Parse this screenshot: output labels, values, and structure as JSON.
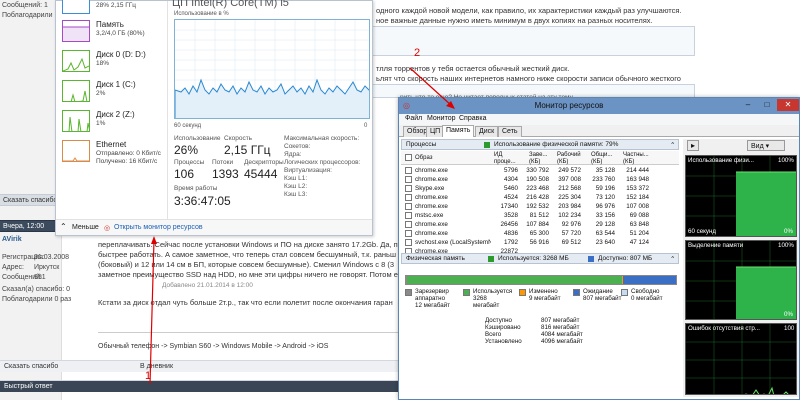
{
  "forum": {
    "left": {
      "top_line1": "Сообщений: 1",
      "top_line2": "Поблагодарили 1 раз",
      "bar1": "Сказать спасибо",
      "bar2": "Вчера, 12:00",
      "user": "AVirik",
      "reg_label": "Регистрация:",
      "reg_value": "31.03.2008",
      "addr_label": "Адрес:",
      "addr_value": "Иркутск",
      "msgs_label": "Сообщений:",
      "msgs_value": "951",
      "thanked_label": "Сказал(а) спасибо: 0",
      "thanked2_label": "Поблагодарили 0 раз"
    },
    "top_right": {
      "line1": "одного каждой новой модели, как правило, их характеристики каждый раз улучшаются.",
      "line2": "ное важные данные нужно иметь минимум в двух копиях на разных носителях.",
      "line3": "тлля торрентов у тебя остается обычный жесткий диск.",
      "line4": "ьлят что скорость наших интернетов намного ниже скорости записи обычного жесткого",
      "line5": "рить что-то еще? Не читает поводных статей на эту тему"
    },
    "post": {
      "l1": "переплачивать. Сейчас после установки Windows и ПО на диске занято 17.2Gb. Да, п",
      "l2": "быстрее работать. А самое заметное, что теперь стал совсем бесшумный, т.к. раньш",
      "l3": "(боковый) и 12 или 14 см в БП, которые совсем бесшумные). Сменил Windows с 8 (3",
      "l4": "заметное преимущество SSD над HDD, но мне эти цифры ничего не говорят. Потом ещ",
      "added": "Добавлено 21.01.2014 в 12:00",
      "l5": "Кстати за диск отдал чуть больше 2т.р., так что если полетит после окончания гаран",
      "signature": "Обычный телефон -> Symbian S60 -> Windows Mobile -> Android -> iOS"
    },
    "bottom": {
      "bar1_left": "Сказать спасибо",
      "bar1_right": "В дневник",
      "bar2": "Быстрый ответ"
    }
  },
  "taskmgr": {
    "side": [
      {
        "name": "",
        "sub": "28% 2,15 ГГц",
        "sub2": ""
      },
      {
        "name": "Память",
        "sub": "3,2/4,0 ГБ (80%)",
        "sub2": ""
      },
      {
        "name": "Диск 0 (D: D:)",
        "sub": "18%",
        "sub2": ""
      },
      {
        "name": "Диск 1 (C:)",
        "sub": "2%",
        "sub2": ""
      },
      {
        "name": "Диск 2 (Z:)",
        "sub": "1%",
        "sub2": ""
      },
      {
        "name": "Ethernet",
        "sub": "Отправлено: 0 Кбит/с",
        "sub2": "Получено: 16 Кбит/с"
      }
    ],
    "title": "ЦП     Intel(R) Core(TM) i5",
    "util_label": "Использование в %",
    "sixty": "60 секунд",
    "zero": "0",
    "usage_label": "Использование",
    "usage_value": "26%",
    "speed_label": "Скорость",
    "speed_value": "2,15 ГГц",
    "proc_label": "Процессы",
    "proc_value": "106",
    "threads_label": "Потоки",
    "threads_value": "1393",
    "handles_label": "Дескрипторы",
    "handles_value": "45444",
    "uptime_label": "Время работы",
    "uptime_value": "3:36:47:05",
    "right_labels": [
      "Максимальная скорость:",
      "Сокетов:",
      "Ядра:",
      "Логических процессоров:",
      "Виртуализация:",
      "Кэш L1:",
      "Кэш L2:",
      "Кэш L3:"
    ],
    "less": "Меньше",
    "open_resmon": "Открыть монитор ресурсов"
  },
  "resmon": {
    "title": "Монитор ресурсов",
    "menu": [
      "Файл",
      "Монитор",
      "Справка"
    ],
    "tabs": [
      "Обзор",
      "ЦП",
      "Память",
      "Диск",
      "Сеть"
    ],
    "active_tab": "Память",
    "proc_section": "Процессы",
    "proc_usage": "Использование физической памяти: 79%",
    "columns": [
      "Образ",
      "ИД\nпроце...",
      "Заве...\n(КБ)",
      "Рабочий\n(КБ)",
      "Общи...\n(КБ)",
      "Частны...\n(КБ)"
    ],
    "rows": [
      [
        "chrome.exe",
        "5796",
        "330 792",
        "249 572",
        "35 128",
        "214 444"
      ],
      [
        "chrome.exe",
        "4304",
        "190 508",
        "397 008",
        "233 760",
        "163 948"
      ],
      [
        "Skype.exe",
        "5460",
        "223 468",
        "212 568",
        "59 196",
        "153 372"
      ],
      [
        "chrome.exe",
        "4524",
        "216 428",
        "225 304",
        "73 120",
        "152 184"
      ],
      [
        "chrome.exe",
        "17340",
        "192 532",
        "203 984",
        "96 976",
        "107 008"
      ],
      [
        "mstsc.exe",
        "3528",
        "81 512",
        "102 234",
        "33 156",
        "69 088"
      ],
      [
        "chrome.exe",
        "26456",
        "107 884",
        "92 976",
        "29 128",
        "63 848"
      ],
      [
        "chrome.exe",
        "4836",
        "65 300",
        "57 720",
        "63 544",
        "51 204"
      ],
      [
        "svchost.exe (LocalSystemNet...",
        "1792",
        "56 916",
        "69 512",
        "23 640",
        "47 124"
      ],
      [
        "chrome.exe",
        "22872",
        "",
        "",
        "",
        ""
      ]
    ],
    "phys_section": "Физическая память",
    "phys_used": "Используется: 3268 МБ",
    "phys_avail": "Доступно: 807 МБ",
    "legend": [
      {
        "label": "Зарезервир\nаппаратно\n12 мегабайт",
        "color": "#8a8a8a"
      },
      {
        "label": "Используется\n3268\nмегабайт",
        "color": "#4caf50"
      },
      {
        "label": "Изменено\n9 мегабайт",
        "color": "#ff9800"
      },
      {
        "label": "Ожидание\n807 мегабайт",
        "color": "#3b6fc6"
      },
      {
        "label": "Свободно\n0 мегабайт",
        "color": "#c6dcf5"
      }
    ],
    "mem_stats": [
      {
        "label": "Доступно",
        "value": "807 мегабайт"
      },
      {
        "label": "Кэшировано",
        "value": "816 мегабайт"
      },
      {
        "label": "Всего",
        "value": "4084 мегабайт"
      },
      {
        "label": "Установлено",
        "value": "4096 мегабайт"
      }
    ],
    "view_button": "Вид",
    "graphs": [
      {
        "title": "Использование физи...",
        "max": "100%",
        "xlabel": "60 секунд",
        "min": "0%"
      },
      {
        "title": "Выделение памяти",
        "max": "100%",
        "xlabel": "",
        "min": "0%"
      },
      {
        "title": "Ошибок отсутствия стр...",
        "max": "100",
        "xlabel": "",
        "min": ""
      }
    ],
    "colors": {
      "used": "#4caf50",
      "modified": "#ff9800",
      "standby": "#3b6fc6",
      "free": "#c6dcf5",
      "hw": "#8a8a8a"
    },
    "membar": {
      "hw_mb": 12,
      "used_mb": 3268,
      "modified_mb": 9,
      "standby_mb": 807,
      "free_mb": 0
    }
  },
  "annotations": {
    "one": "1",
    "two": "2"
  }
}
